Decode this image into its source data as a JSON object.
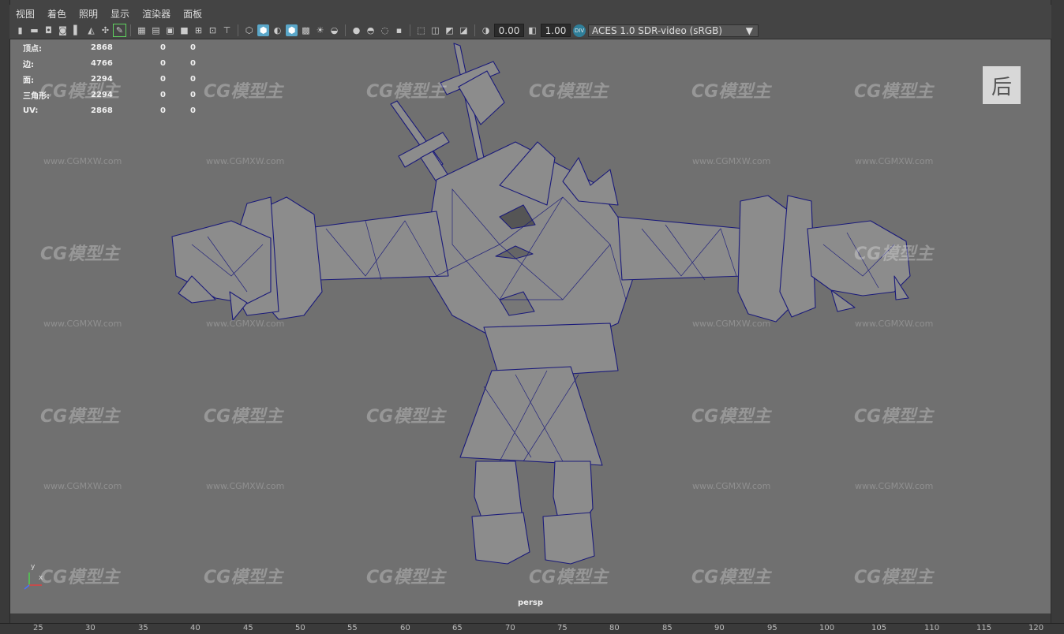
{
  "menu": [
    "视图",
    "着色",
    "照明",
    "显示",
    "渲染器",
    "面板"
  ],
  "toolbar": {
    "exposure_value": "0.00",
    "gamma_value": "1.00",
    "colorspace_badge": "DIV",
    "colorspace_label": "ACES 1.0 SDR-video (sRGB)"
  },
  "hud": {
    "rows": [
      {
        "label": "顶点:",
        "c1": "2868",
        "c2": "0",
        "c3": "0"
      },
      {
        "label": "边:",
        "c1": "4766",
        "c2": "0",
        "c3": "0"
      },
      {
        "label": "面:",
        "c1": "2294",
        "c2": "0",
        "c3": "0"
      },
      {
        "label": "三角形:",
        "c1": "2294",
        "c2": "0",
        "c3": "0"
      },
      {
        "label": "UV:",
        "c1": "2868",
        "c2": "0",
        "c3": "0"
      }
    ]
  },
  "viewport": {
    "camera_label": "persp",
    "view_badge": "后",
    "watermark_logo": "CG模型主",
    "watermark_url": "www.CGMXW.com"
  },
  "axis": {
    "x": "x",
    "y": "y"
  },
  "ruler": {
    "ticks": [
      "25",
      "30",
      "35",
      "40",
      "45",
      "50",
      "55",
      "60",
      "65",
      "70",
      "75",
      "80",
      "85",
      "90",
      "95",
      "100",
      "105",
      "110",
      "115",
      "120"
    ]
  },
  "colors": {
    "viewport_bg": "#707070",
    "wire": "#1a1a7a",
    "mesh": "#8a8a8a",
    "accent": "#5aa7c9"
  }
}
